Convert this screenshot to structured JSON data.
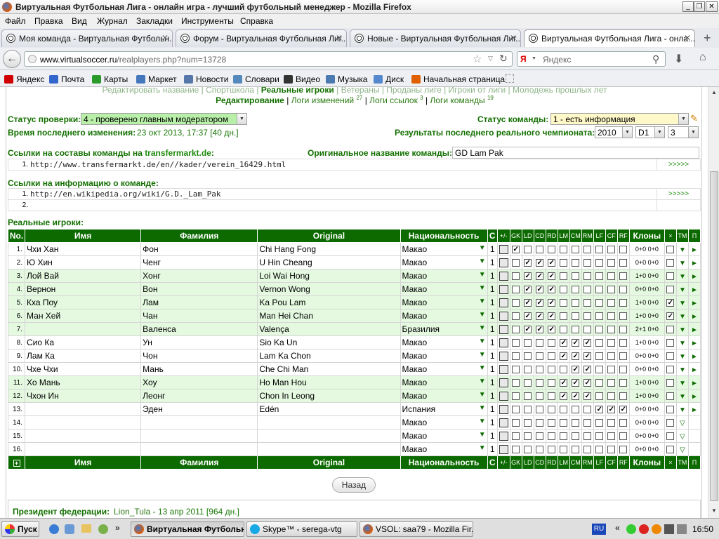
{
  "window": {
    "title": "Виртуальная Футбольная Лига - онлайн игра - лучший футбольный менеджер - Mozilla Firefox"
  },
  "menu": [
    "Файл",
    "Правка",
    "Вид",
    "Журнал",
    "Закладки",
    "Инструменты",
    "Справка"
  ],
  "tabs": [
    {
      "label": "Моя команда - Виртуальная Футбольн..."
    },
    {
      "label": "Форум - Виртуальная Футбольная Лиг..."
    },
    {
      "label": "Новые - Виртуальная Футбольная Лиг..."
    },
    {
      "label": "Виртуальная Футбольная Лига - онла..."
    }
  ],
  "url": {
    "host": "www.virtualsoccer.ru",
    "path": "/realplayers.php?num=13728"
  },
  "search": {
    "placeholder": "Яндекс"
  },
  "bookmarks": [
    {
      "label": "Яндекс",
      "color": "#d00000"
    },
    {
      "label": "Почта",
      "color": "#3366cc"
    },
    {
      "label": "Карты",
      "color": "#2a9a2a"
    },
    {
      "label": "Маркет",
      "color": "#4477bb"
    },
    {
      "label": "Новости",
      "color": "#5577aa"
    },
    {
      "label": "Словари",
      "color": "#5588bb"
    },
    {
      "label": "Видео",
      "color": "#333333"
    },
    {
      "label": "Музыка",
      "color": "#4a7ab0"
    },
    {
      "label": "Диск",
      "color": "#5588cc"
    },
    {
      "label": "Начальная страница",
      "color": "#e06000"
    }
  ],
  "topnav": {
    "line1": [
      "Редактировать название",
      "Спортшкола",
      "Реальные игроки",
      "Ветераны",
      "Проданы лиге",
      "Игроки от лиги",
      "Молодежь прошлых лет"
    ],
    "line2": {
      "edit": "Редактирование",
      "changes": "Логи изменений",
      "changes_count": "27",
      "links": "Логи ссылок",
      "links_count": "3",
      "team": "Логи команды",
      "team_count": "19"
    }
  },
  "check": {
    "label": "Статус проверки:",
    "value": "4 - проверено главным модератором"
  },
  "team_status": {
    "label": "Статус команды:",
    "value": "1 - есть информация"
  },
  "last_change": {
    "label": "Время последнего изменения:",
    "value": "23 окт 2013, 17:37 [40 дн.]"
  },
  "results": {
    "label": "Результаты последнего реального чемпионата:",
    "year": "2010",
    "div": "D1",
    "place": "3"
  },
  "transfermarkt": {
    "label": "Ссылки на составы команды на",
    "site": "transfermarkt.de",
    "colon": ":",
    "links": [
      "http://www.transfermarkt.de/en//kader/verein_16429.html"
    ],
    "more": ">>>>>"
  },
  "original_name": {
    "label": "Оригинальное название команды:",
    "value": "GD Lam Pak"
  },
  "info": {
    "label": "Ссылки на информацию о команде:",
    "links": [
      "http://en.wikipedia.org/wiki/G.D._Lam_Pak",
      ""
    ],
    "more": ">>>>>"
  },
  "players_title": "Реальные игроки:",
  "columns": {
    "no": "No.",
    "first": "Имя",
    "last": "Фамилия",
    "orig": "Original",
    "nat": "Национальность",
    "c": "С",
    "pm": "+/-",
    "pos": [
      "GK",
      "LD",
      "CD",
      "RD",
      "LM",
      "CM",
      "RM",
      "LF",
      "CF",
      "RF"
    ],
    "clones": "Клоны",
    "x": "×",
    "tm": "ТМ",
    "p": "П"
  },
  "players": [
    {
      "n": "1.",
      "first": "Чхи Хан",
      "last": "Фон",
      "orig": "Chi Hang Fong",
      "nat": "Макао",
      "c": "1",
      "pos": [
        1,
        0,
        0,
        0,
        0,
        0,
        0,
        0,
        0,
        0
      ],
      "clones": "0+0 0+0",
      "x": 0
    },
    {
      "n": "2.",
      "first": "Ю Хин",
      "last": "Ченг",
      "orig": "U Hin Cheang",
      "nat": "Макао",
      "c": "1",
      "pos": [
        0,
        1,
        1,
        1,
        0,
        0,
        0,
        0,
        0,
        0
      ],
      "clones": "0+0 0+0",
      "x": 0
    },
    {
      "n": "3.",
      "first": "Лой Вай",
      "last": "Хонг",
      "orig": "Loi Wai Hong",
      "nat": "Макао",
      "c": "1",
      "pos": [
        0,
        1,
        1,
        1,
        0,
        0,
        0,
        0,
        0,
        0
      ],
      "clones": "1+0 0+0",
      "x": 0
    },
    {
      "n": "4.",
      "first": "Вернон",
      "last": "Вон",
      "orig": "Vernon Wong",
      "nat": "Макао",
      "c": "1",
      "pos": [
        0,
        1,
        1,
        1,
        0,
        0,
        0,
        0,
        0,
        0
      ],
      "clones": "0+0 0+0",
      "x": 0
    },
    {
      "n": "5.",
      "first": "Кха Поу",
      "last": "Лам",
      "orig": "Ka Pou Lam",
      "nat": "Макао",
      "c": "1",
      "pos": [
        0,
        1,
        1,
        1,
        0,
        0,
        0,
        0,
        0,
        0
      ],
      "clones": "1+0 0+0",
      "x": 1
    },
    {
      "n": "6.",
      "first": "Ман Хей",
      "last": "Чан",
      "orig": "Man Hei Chan",
      "nat": "Макао",
      "c": "1",
      "pos": [
        0,
        1,
        1,
        1,
        0,
        0,
        0,
        0,
        0,
        0
      ],
      "clones": "1+0 0+0",
      "x": 1
    },
    {
      "n": "7.",
      "first": "",
      "last": "Валенса",
      "orig": "Valença",
      "nat": "Бразилия",
      "c": "1",
      "pos": [
        0,
        1,
        1,
        1,
        0,
        0,
        0,
        0,
        0,
        0
      ],
      "clones": "2+1 0+0",
      "x": 0
    },
    {
      "n": "8.",
      "first": "Сио Ка",
      "last": "Ун",
      "orig": "Sio Ka Un",
      "nat": "Макао",
      "c": "1",
      "pos": [
        0,
        0,
        0,
        0,
        1,
        1,
        1,
        0,
        0,
        0
      ],
      "clones": "1+0 0+0",
      "x": 0
    },
    {
      "n": "9.",
      "first": "Лам Ка",
      "last": "Чон",
      "orig": "Lam Ka Chon",
      "nat": "Макао",
      "c": "1",
      "pos": [
        0,
        0,
        0,
        0,
        1,
        1,
        1,
        0,
        0,
        0
      ],
      "clones": "0+0 0+0",
      "x": 0
    },
    {
      "n": "10.",
      "first": "Чхе Чхи",
      "last": "Мань",
      "orig": "Che Chi Man",
      "nat": "Макао",
      "c": "1",
      "pos": [
        0,
        0,
        0,
        0,
        0,
        1,
        1,
        0,
        0,
        0
      ],
      "clones": "0+0 0+0",
      "x": 0
    },
    {
      "n": "11.",
      "first": "Хо Мань",
      "last": "Хоу",
      "orig": "Ho Man Hou",
      "nat": "Макао",
      "c": "1",
      "pos": [
        0,
        0,
        0,
        0,
        1,
        1,
        1,
        0,
        0,
        0
      ],
      "clones": "1+0 0+0",
      "x": 0
    },
    {
      "n": "12.",
      "first": "Чхон Ин",
      "last": "Леонг",
      "orig": "Chon In Leong",
      "nat": "Макао",
      "c": "1",
      "pos": [
        0,
        0,
        0,
        0,
        1,
        1,
        1,
        0,
        0,
        0
      ],
      "clones": "1+0 0+0",
      "x": 0
    },
    {
      "n": "13.",
      "first": "",
      "last": "Эден",
      "orig": "Edén",
      "nat": "Испания",
      "c": "1",
      "pos": [
        0,
        0,
        0,
        0,
        0,
        0,
        0,
        1,
        1,
        1
      ],
      "clones": "0+0 0+0",
      "x": 0
    },
    {
      "n": "14.",
      "first": "",
      "last": "",
      "orig": "",
      "nat": "Макао",
      "c": "1",
      "pos": [
        0,
        0,
        0,
        0,
        0,
        0,
        0,
        0,
        0,
        0
      ],
      "clones": "0+0 0+0",
      "x": 0
    },
    {
      "n": "15.",
      "first": "",
      "last": "",
      "orig": "",
      "nat": "Макао",
      "c": "1",
      "pos": [
        0,
        0,
        0,
        0,
        0,
        0,
        0,
        0,
        0,
        0
      ],
      "clones": "0+0 0+0",
      "x": 0
    },
    {
      "n": "16.",
      "first": "",
      "last": "",
      "orig": "",
      "nat": "Макао",
      "c": "1",
      "pos": [
        0,
        0,
        0,
        0,
        0,
        0,
        0,
        0,
        0,
        0
      ],
      "clones": "0+0 0+0",
      "x": 0
    }
  ],
  "back_button": "Назад",
  "president": {
    "label": "Президент федерации:",
    "name": "Lion_Tula",
    "date": " - 13 апр 2011 [964 дн.]"
  },
  "taskbar": {
    "start": "Пуск",
    "items": [
      "Виртуальная Футбольн...",
      "Skype™ - serega-vtg",
      "VSOL: saa79 - Mozilla Fir..."
    ],
    "lang": "RU",
    "time": "16:50"
  },
  "colors": {
    "header_green": "#0c6a00",
    "alt_row": "#e4f9e0",
    "link_green": "#2a7a10"
  }
}
